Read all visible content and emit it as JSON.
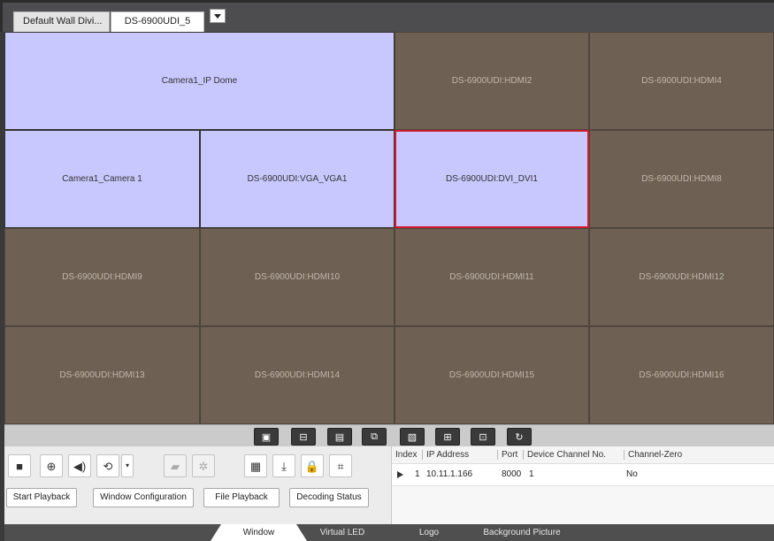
{
  "tabs": {
    "first": "Default Wall Divi...",
    "active": "DS-6900UDI_5"
  },
  "wall": {
    "cells": [
      {
        "label": "Camera1_IP Dome",
        "state": "video"
      },
      {
        "label": "DS-6900UDI:HDMI2",
        "state": "empty"
      },
      {
        "label": "DS-6900UDI:HDMI4",
        "state": "empty"
      },
      {
        "label": "Camera1_Camera 1",
        "state": "video"
      },
      {
        "label": "DS-6900UDI:VGA_VGA1",
        "state": "video"
      },
      {
        "label": "DS-6900UDI:DVI_DVI1",
        "state": "video-selected"
      },
      {
        "label": "DS-6900UDI:HDMI8",
        "state": "empty"
      },
      {
        "label": "DS-6900UDI:HDMI9",
        "state": "empty"
      },
      {
        "label": "DS-6900UDI:HDMI10",
        "state": "empty"
      },
      {
        "label": "DS-6900UDI:HDMI11",
        "state": "empty"
      },
      {
        "label": "DS-6900UDI:HDMI12",
        "state": "empty"
      },
      {
        "label": "DS-6900UDI:HDMI13",
        "state": "empty"
      },
      {
        "label": "DS-6900UDI:HDMI14",
        "state": "empty"
      },
      {
        "label": "DS-6900UDI:HDMI15",
        "state": "empty"
      },
      {
        "label": "DS-6900UDI:HDMI16",
        "state": "empty"
      }
    ]
  },
  "toolstrip": {
    "icons": [
      "screen-icon",
      "monitor-icon",
      "window-icon",
      "roaming-icon",
      "picture-icon",
      "split-icon",
      "fullscreen-icon",
      "refresh-icon"
    ]
  },
  "controls": {
    "icons": [
      "stop-icon",
      "zoom-icon",
      "audio-icon",
      "rewind-icon",
      "dropdown-icon",
      "camera-icon",
      "aperture-icon",
      "layout-icon",
      "download-icon",
      "lock-icon",
      "expand-icon"
    ],
    "buttons": {
      "start_playback": "Start Playback",
      "window_configuration": "Window Configuration",
      "file_playback": "File Playback",
      "decoding_status": "Decoding Status"
    }
  },
  "device_table": {
    "headers": {
      "index": "Index",
      "ip_address": "IP Address",
      "port": "Port",
      "device_channel": "Device Channel No.",
      "channel_zero": "Channel-Zero"
    },
    "rows": [
      {
        "index": "1",
        "ip_address": "10.11.1.166",
        "port": "8000",
        "device_channel": "1",
        "channel_zero": "No"
      }
    ]
  },
  "bottom_tabs": {
    "window": "Window",
    "virtual_led": "Virtual LED",
    "logo": "Logo",
    "background_picture": "Background Picture"
  },
  "colors": {
    "video_cell": "#c8c8fe",
    "empty_cell": "#6e6052",
    "selected_border": "#d21a2e"
  }
}
